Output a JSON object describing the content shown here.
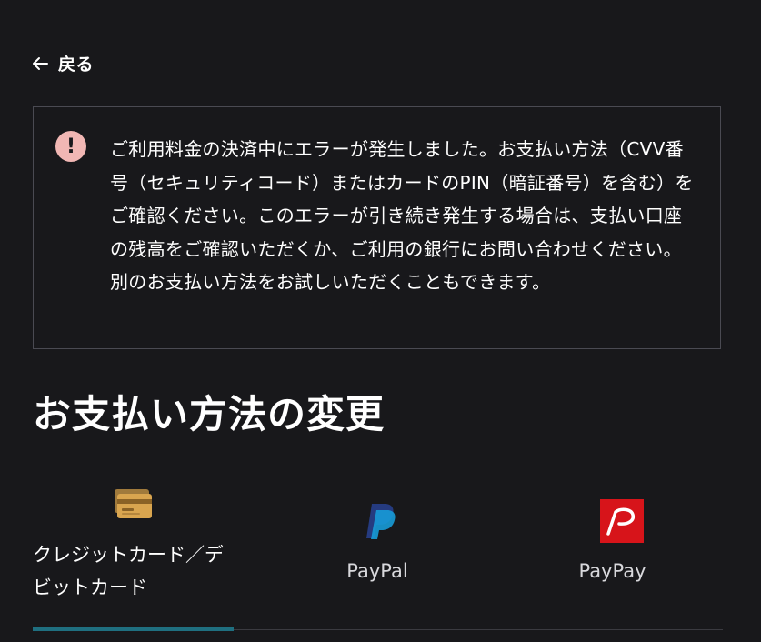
{
  "nav": {
    "back_label": "戻る",
    "back_icon": "arrow-left-icon"
  },
  "error": {
    "icon": "exclamation-icon",
    "icon_color": "#f1b7b4",
    "message": "ご利用料金の決済中にエラーが発生しました。お支払い方法（CVV番号（セキュリティコード）またはカードのPIN（暗証番号）を含む）をご確認ください。このエラーが引き続き発生する場合は、支払い口座の残高をご確認いただくか、ご利用の銀行にお問い合わせください。別のお支払い方法をお試しいただくこともできます。"
  },
  "section": {
    "title": "お支払い方法の変更"
  },
  "tabs": [
    {
      "label": "クレジットカード／デビットカード",
      "icon": "credit-card-icon",
      "active": true
    },
    {
      "label": "PayPal",
      "icon": "paypal-icon",
      "active": false
    },
    {
      "label": "PayPay",
      "icon": "paypay-icon",
      "active": false
    }
  ],
  "colors": {
    "background": "#18181b",
    "active_tab": "#1f6f80",
    "paypay_red": "#d7141a",
    "paypal_navy": "#253b80",
    "paypal_blue": "#179bd7"
  }
}
